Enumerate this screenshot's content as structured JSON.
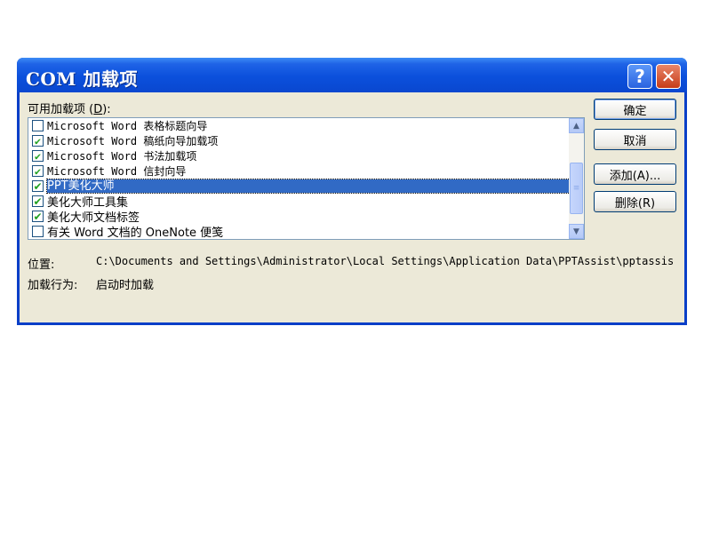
{
  "window": {
    "title": "COM 加载项",
    "help_glyph": "?",
    "close_glyph": "✕"
  },
  "available_label": {
    "prefix": "可用加载项 (",
    "mnemonic": "D",
    "suffix": "):"
  },
  "addins": [
    {
      "text": "Microsoft Word 表格标题向导",
      "checked": false,
      "selected": false
    },
    {
      "text": "Microsoft Word 稿纸向导加载项",
      "checked": true,
      "selected": false
    },
    {
      "text": "Microsoft Word 书法加载项",
      "checked": true,
      "selected": false
    },
    {
      "text": "Microsoft Word 信封向导",
      "checked": true,
      "selected": false
    },
    {
      "text": "PPT美化大师",
      "checked": true,
      "selected": true
    },
    {
      "text": "美化大师工具集",
      "checked": true,
      "selected": false
    },
    {
      "text": "美化大师文档标签",
      "checked": true,
      "selected": false
    },
    {
      "text": "有关 Word 文档的 OneNote 便笺",
      "checked": false,
      "selected": false
    }
  ],
  "check_glyph": "✔",
  "scrollbar": {
    "up_glyph": "▲",
    "down_glyph": "▼",
    "grip_glyph": "≡"
  },
  "buttons": {
    "ok": "确定",
    "cancel": "取消",
    "add": "添加(A)...",
    "remove": "删除(R)"
  },
  "location": {
    "label": "位置:",
    "value": "C:\\Documents and Settings\\Administrator\\Local Settings\\Application Data\\PPTAssist\\pptassis"
  },
  "load_behavior": {
    "label": "加载行为:",
    "value": "启动时加载"
  }
}
